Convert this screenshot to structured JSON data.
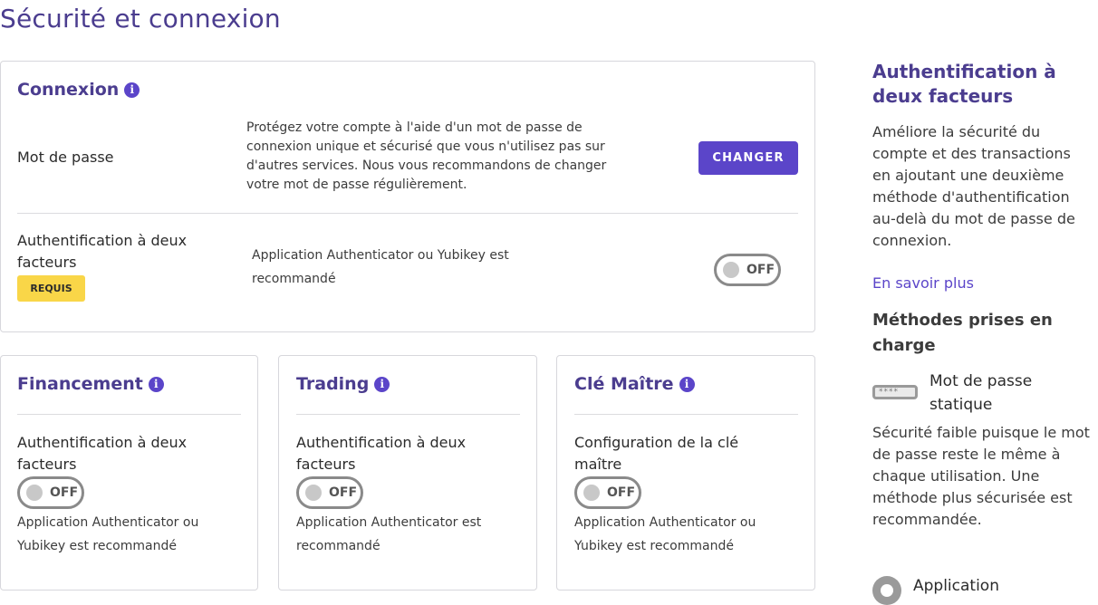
{
  "page": {
    "title": "Sécurité et connexion"
  },
  "connexion": {
    "title": "Connexion",
    "info_icon": "i",
    "password": {
      "label": "Mot de passe",
      "description": "Protégez votre compte à l'aide d'un mot de passe de connexion unique et sécurisé que vous n'utilisez pas sur d'autres services. Nous vous recommandons de changer votre mot de passe régulièrement.",
      "button": "CHANGER"
    },
    "two_factor": {
      "label": "Authentification à deux facteurs",
      "badge": "REQUIS",
      "description": "Application Authenticator ou Yubikey est recommandé",
      "toggle": "OFF"
    }
  },
  "cards": [
    {
      "title": "Financement",
      "info_icon": "i",
      "label": "Authentification à deux facteurs",
      "toggle": "OFF",
      "description": "Application Authenticator ou Yubikey est recommandé"
    },
    {
      "title": "Trading",
      "info_icon": "i",
      "label": "Authentification à deux facteurs",
      "toggle": "OFF",
      "description": "Application Authenticator est recommandé"
    },
    {
      "title": "Clé Maître",
      "info_icon": "i",
      "label": "Configuration de la clé maître",
      "toggle": "OFF",
      "description": "Application Authenticator ou Yubikey est recommandé"
    }
  ],
  "sidebar": {
    "title": "Authentification à deux facteurs",
    "text": "Améliore la sécurité du compte et des transactions en ajoutant une deuxième méthode d'authentification au-delà du mot de passe de connexion.",
    "link": "En savoir plus",
    "methods_title": "Méthodes prises en charge",
    "methods": [
      {
        "icon": "password-icon",
        "icon_text": "****",
        "name": "Mot de passe statique",
        "description": "Sécurité faible puisque le mot de passe reste le même à chaque utilisation. Une méthode plus sécurisée est recommandée."
      },
      {
        "icon": "app-icon",
        "name": "Application"
      }
    ]
  },
  "colors": {
    "accent": "#5b45c9",
    "title": "#4b3d8f",
    "badge": "#f9d648"
  }
}
